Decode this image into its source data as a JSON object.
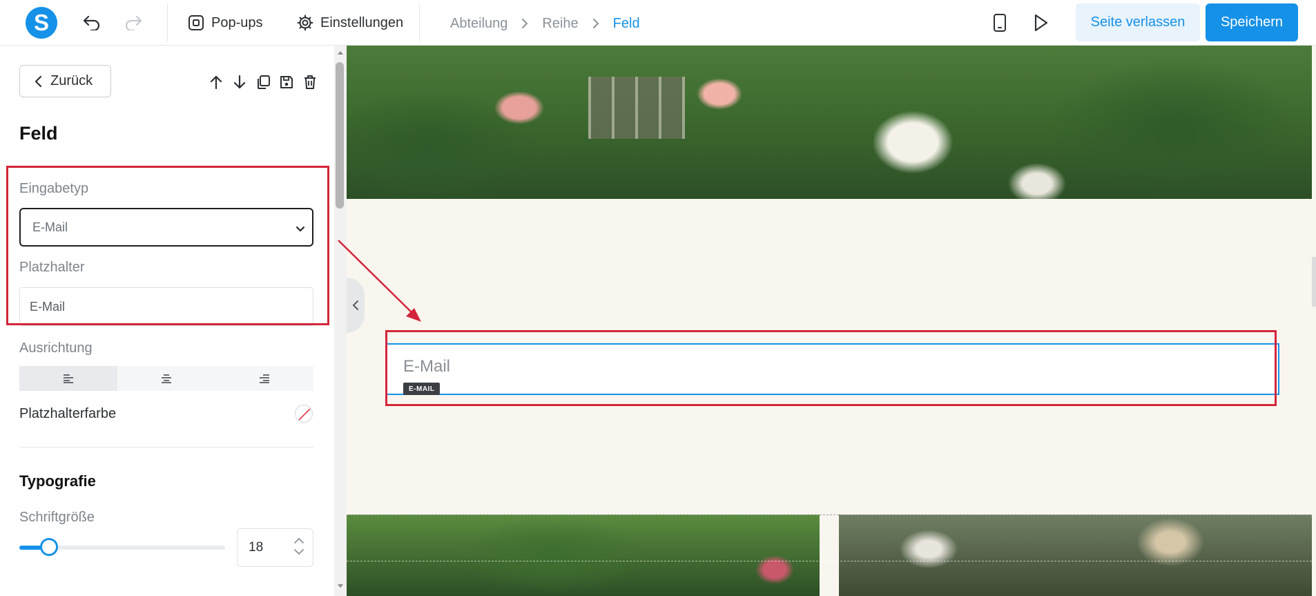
{
  "topbar": {
    "logo_letter": "S",
    "popups_label": "Pop-ups",
    "settings_label": "Einstellungen",
    "breadcrumb": [
      "Abteilung",
      "Reihe",
      "Feld"
    ],
    "leave_label": "Seite verlassen",
    "save_label": "Speichern",
    "icons": [
      "undo-icon",
      "redo-icon",
      "popup-icon",
      "gear-icon",
      "mobile-preview-icon",
      "play-icon"
    ]
  },
  "sidebar": {
    "back_label": "Zurück",
    "title": "Feld",
    "input_type_label": "Eingabetyp",
    "input_type_value": "E-Mail",
    "placeholder_label": "Platzhalter",
    "placeholder_value": "E-Mail",
    "alignment_label": "Ausrichtung",
    "alignment_options": [
      "left",
      "center",
      "right"
    ],
    "alignment_selected": "left",
    "placeholder_color_label": "Platzhalterfarbe",
    "typography_title": "Typografie",
    "font_size_label": "Schriftgröße",
    "font_size_value": "18",
    "font_size_slider_fraction": 0.12
  },
  "canvas": {
    "field_placeholder": "E-Mail",
    "field_badge": "E-MAIL"
  },
  "colors": {
    "accent": "#1691e8",
    "annotation": "#d3253a",
    "canvas_bg": "#f9f6ef"
  }
}
